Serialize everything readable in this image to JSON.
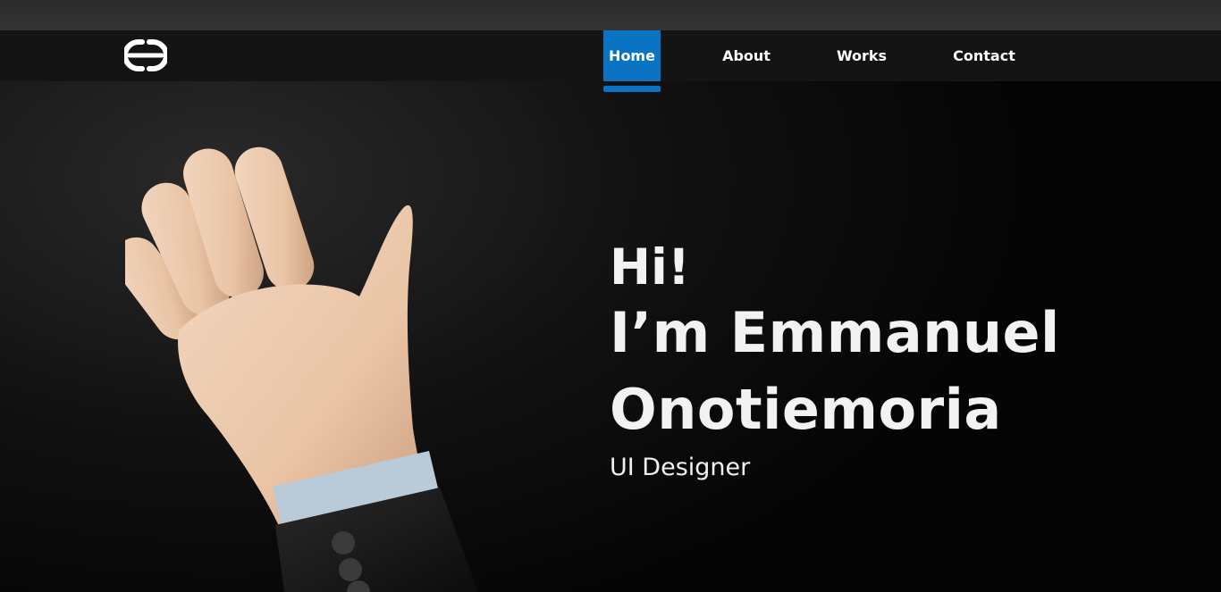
{
  "brand": {
    "logo_icon": "logo-icon"
  },
  "nav": {
    "items": [
      {
        "label": "Home",
        "active": true
      },
      {
        "label": "About",
        "active": false
      },
      {
        "label": "Works",
        "active": false
      },
      {
        "label": "Contact",
        "active": false
      }
    ]
  },
  "hero": {
    "greeting": "Hi!",
    "name_line_1": "I’m Emmanuel",
    "name_line_2": "Onotiemoria",
    "role": "UI Designer",
    "illustration_icon": "waving-hand-icon"
  },
  "colors": {
    "accent": "#0a73c4",
    "navbar_bg": "#141414",
    "page_bg": "#050505",
    "text": "#f2f2f2"
  }
}
